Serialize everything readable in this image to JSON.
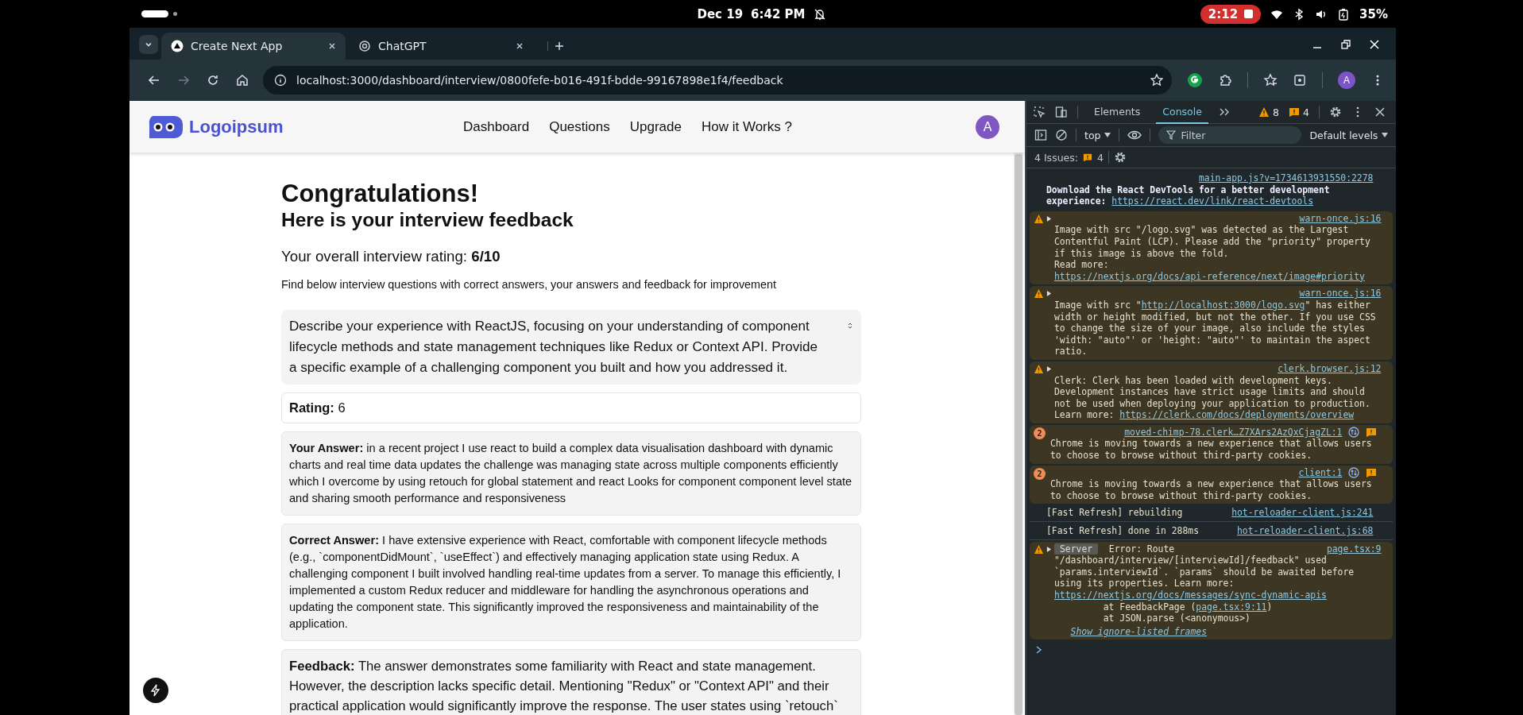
{
  "status_bar": {
    "date": "Dec 19",
    "time": "6:42 PM",
    "timer": "2:12",
    "battery": "35%"
  },
  "browser": {
    "tabs": [
      {
        "title": "Create Next App",
        "kind": "next",
        "selected": true
      },
      {
        "title": "ChatGPT",
        "kind": "chatgpt",
        "selected": false
      }
    ],
    "address": "localhost:3000/dashboard/interview/0800fefe-b016-491f-bdde-99167898e1f4/feedback",
    "profile": "A"
  },
  "app": {
    "logo": "Logoipsum",
    "nav": [
      "Dashboard",
      "Questions",
      "Upgrade",
      "How it Works ?"
    ],
    "avatar": "A"
  },
  "feedback": {
    "title": "Congratulations!",
    "subtitle": "Here is your interview feedback",
    "overall": "Your overall interview rating: **6/10**",
    "intro": "Find below interview questions with correct answers, your answers and feedback for improvement",
    "items": [
      {
        "question": "Describe your experience with ReactJS, focusing on your understanding of component lifecycle methods and state management techniques like Redux or Context API. Provide a specific example of a challenging component you built and how you addressed it.",
        "expanded": true,
        "rating": "**Rating:** 6",
        "user_answer": "**Your Answer:** in a recent project I use react to build a complex data visualisation dashboard with dynamic charts and real time data updates the challenge was managing state across multiple components efficiently which I overcome by using retouch for global statement and react Looks for component component level state and sharing smooth performance and responsiveness",
        "correct_answer": "**Correct Answer:** I have extensive experience with React, comfortable with component lifecycle methods (e.g., `componentDidMount`, `useEffect`) and effectively managing application state using Redux. A challenging component I built involved handling real-time updates from a server. To manage this efficiently, I implemented a custom Redux reducer and middleware for handling the asynchronous operations and updating the component state. This significantly improved the responsiveness and maintainability of the application.",
        "feedback": "**Feedback:** The answer demonstrates some familiarity with React and state management. However, the description lacks specific detail. Mentioning \"Redux\" or \"Context API\" and their practical application would significantly improve the response. The user states using `retouch`"
      }
    ]
  },
  "devtools": {
    "tabs": [
      {
        "label": "Elements",
        "selected": false
      },
      {
        "label": "Console",
        "selected": true
      }
    ],
    "warnings": "8",
    "issues": "4",
    "context": "top",
    "filter_placeholder": "Filter",
    "levels": "Default levels",
    "issues_label": "4 Issues:",
    "issues_count": "4",
    "messages": [
      {
        "kind": "info",
        "source": "main-app.js?v=1734613931550:2278",
        "parts": [
          {
            "kind": "text",
            "text": "Download the React DevTools for a better development experience: "
          },
          {
            "kind": "link",
            "text": "https://react.dev/link/react-devtools"
          }
        ]
      },
      {
        "kind": "warning",
        "source": "warn-once.js:16",
        "parts": [
          {
            "kind": "text",
            "text": "Image with src \"/logo.svg\" was detected as the Largest Contentful Paint (LCP). Please add the \"priority\" property if this image is above the fold.\nRead more: "
          },
          {
            "kind": "link",
            "text": "https://nextjs.org/docs/api-reference/next/image#priority"
          }
        ]
      },
      {
        "kind": "warning",
        "source": "warn-once.js:16",
        "parts": [
          {
            "kind": "text",
            "text": "Image with src \""
          },
          {
            "kind": "link",
            "text": "http://localhost:3000/logo.svg"
          },
          {
            "kind": "text",
            "text": "\" has either width or height modified, but not the other. If you use CSS to change the size of your image, also include the styles 'width: \"auto\"' or 'height: \"auto\"' to maintain the aspect ratio."
          }
        ]
      },
      {
        "kind": "warning",
        "source": "clerk.browser.js:12",
        "parts": [
          {
            "kind": "text",
            "text": "Clerk: Clerk has been loaded with development keys. Development instances have strict usage limits and should not be used when deploying your application to production. Learn more: "
          },
          {
            "kind": "link",
            "text": "https://clerk.com/docs/deployments/overview"
          }
        ]
      },
      {
        "kind": "issue",
        "count": "2",
        "source": "moved-chimp-78.clerk…Z7XArs2AzQxCjagZL:1",
        "parts": [
          {
            "kind": "text",
            "text": "Chrome is moving towards a new experience that allows users to choose to browse without third-party cookies."
          }
        ]
      },
      {
        "kind": "issue",
        "count": "2",
        "source": "client:1",
        "parts": [
          {
            "kind": "text",
            "text": "Chrome is moving towards a new experience that allows users to choose to browse without third-party cookies."
          }
        ]
      },
      {
        "kind": "log",
        "source": "hot-reloader-client.js:241",
        "parts": [
          {
            "kind": "text",
            "text": "[Fast Refresh] rebuilding"
          }
        ]
      },
      {
        "kind": "log",
        "source": "hot-reloader-client.js:68",
        "parts": [
          {
            "kind": "text",
            "text": "[Fast Refresh] done in 288ms"
          }
        ]
      },
      {
        "kind": "warning",
        "badge": "Server",
        "source": "page.tsx:9",
        "parts": [
          {
            "kind": "text",
            "text": "Error: Route \"/dashboard/interview/[interviewId]/feedback\" used `params.interviewId`. `params` should be awaited before using its properties. Learn more: "
          },
          {
            "kind": "link",
            "text": "https://nextjs.org/docs/messages/sync-dynamic-apis"
          }
        ],
        "stack": [
          {
            "parts": [
              {
                "kind": "text",
                "text": "at FeedbackPage ("
              },
              {
                "kind": "link",
                "text": "page.tsx:9:11"
              },
              {
                "kind": "text",
                "text": ")"
              }
            ]
          },
          {
            "parts": [
              {
                "kind": "text",
                "text": "at JSON.parse (<anonymous>)"
              }
            ]
          }
        ],
        "more": "Show ignore-listed frames"
      }
    ]
  }
}
